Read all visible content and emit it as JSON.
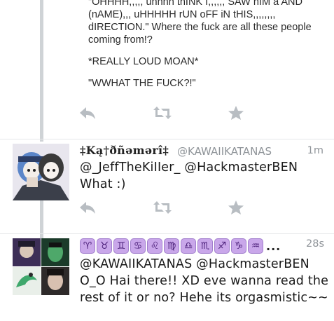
{
  "tweet1": {
    "lines_partial": [
      "\"OHHHH,,,,, uhhhh thINK I,,,,,, SAW hIM a AND (nAME),,, uHHHHH rUN oFF iN tHIS,,,,,,,, dIRECTION.\" Where the fuck are all these people coming from!?",
      "*REALLY LOUD MOAN*",
      "\"WWHAT THE FUCK?!\""
    ]
  },
  "tweet2": {
    "display_name": "‡Ką†ðñəmərî‡",
    "handle": "@KAWAIIKATANAS",
    "time": "1m",
    "text": "@_JeffTheKiIIer_ @HackmasterBEN What :)"
  },
  "tweet3": {
    "zodiac_symbols": [
      "♈",
      "♉",
      "♊",
      "♋",
      "♌",
      "♍",
      "♎",
      "♏",
      "♐",
      "♑",
      "♒"
    ],
    "ellipsis": "...",
    "time": "28s",
    "text": "@KAWAIIKATANAS @HackmasterBEN O_O Hai there!! XD eve wanna read the rest of it or no? Hehe its orgasmistic~~"
  },
  "icons": {
    "reply": "reply-icon",
    "retweet": "retweet-icon",
    "favorite": "star-icon"
  },
  "colors": {
    "action_gray": "#b8bdc2",
    "meta_gray": "#8f9499",
    "zodiac_badge": "#c9a7ea"
  }
}
